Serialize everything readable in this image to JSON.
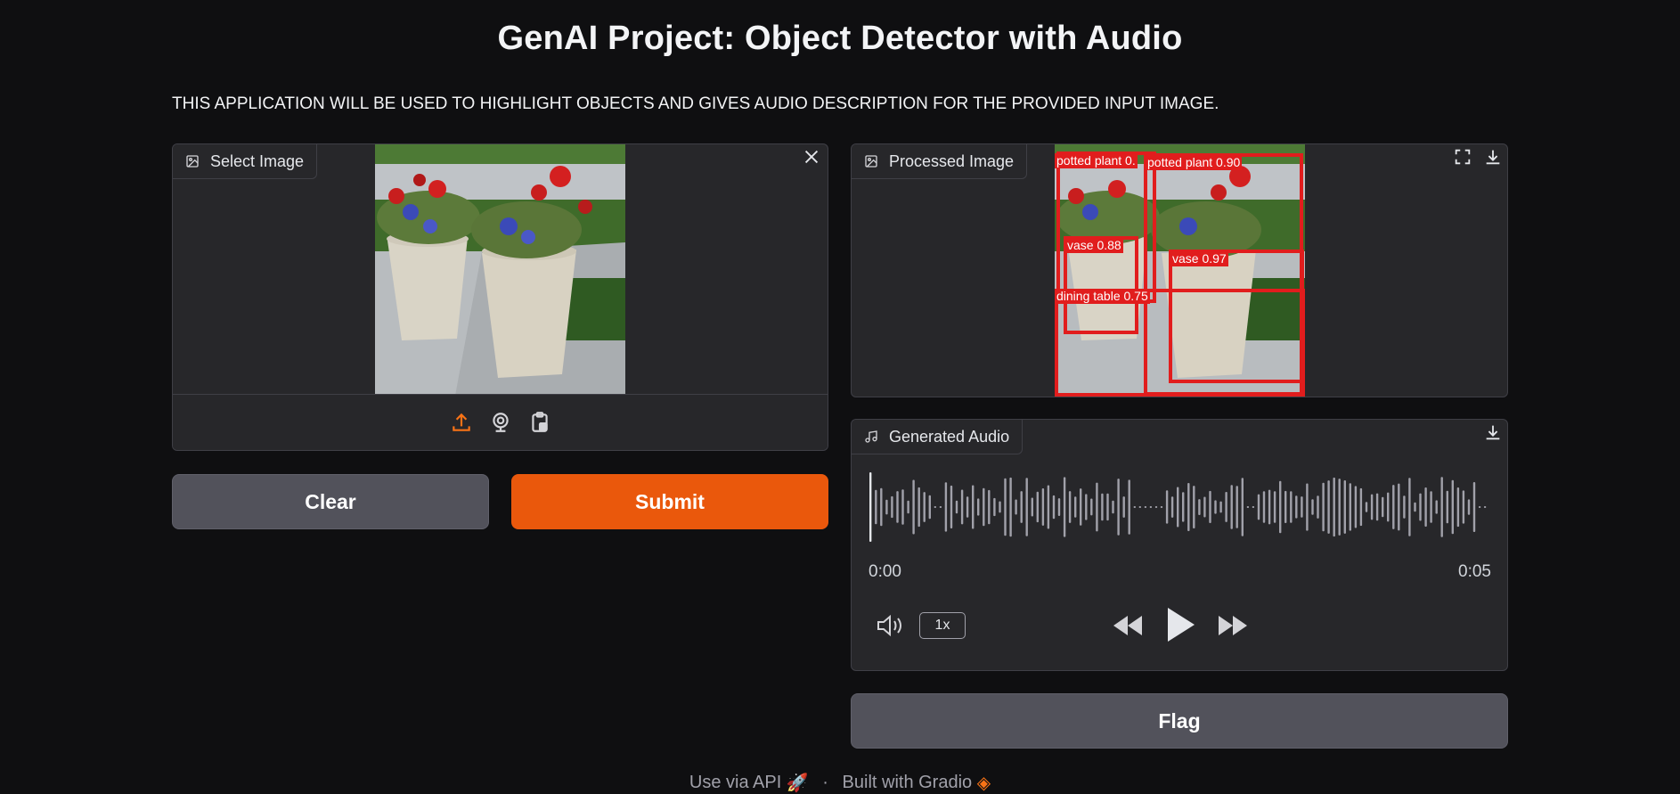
{
  "header": {
    "title": "GenAI Project: Object Detector with Audio",
    "description": "THIS APPLICATION WILL BE USED TO HIGHLIGHT OBJECTS AND GIVES AUDIO DESCRIPTION FOR THE PROVIDED INPUT IMAGE."
  },
  "input_panel": {
    "label": "Select Image",
    "label_icon": "image-icon",
    "clear_icon": "close-icon",
    "sources": [
      {
        "name": "upload-icon",
        "color": "#f97316"
      },
      {
        "name": "webcam-icon",
        "color": "#d4d4d8"
      },
      {
        "name": "clipboard-icon",
        "color": "#d4d4d8"
      }
    ]
  },
  "buttons": {
    "clear_label": "Clear",
    "submit_label": "Submit",
    "flag_label": "Flag"
  },
  "output_panel": {
    "label": "Processed Image",
    "label_icon": "image-icon",
    "fullscreen_icon": "fullscreen-icon",
    "download_icon": "download-icon",
    "detections": [
      {
        "label": "potted plant 0.",
        "color": "#e11d1d"
      },
      {
        "label": "potted plant 0.90",
        "color": "#e11d1d"
      },
      {
        "label": "vase 0.88",
        "color": "#e11d1d"
      },
      {
        "label": "vase 0.97",
        "color": "#e11d1d"
      },
      {
        "label": "dining table 0.75",
        "color": "#e11d1d"
      }
    ]
  },
  "audio_panel": {
    "label": "Generated Audio",
    "label_icon": "music-note-icon",
    "download_icon": "download-icon",
    "time_current": "0:00",
    "time_total": "0:05",
    "playback_rate": "1x",
    "volume_icon": "volume-icon",
    "rewind_icon": "rewind-icon",
    "play_icon": "play-icon",
    "forward_icon": "fast-forward-icon"
  },
  "footer": {
    "api_label": "Use via API",
    "separator": "·",
    "built_label": "Built with Gradio"
  },
  "colors": {
    "background": "#0f0f11",
    "panel": "#27272a",
    "primary": "#ea580c",
    "secondary": "#52525b",
    "detection": "#e11d1d"
  }
}
